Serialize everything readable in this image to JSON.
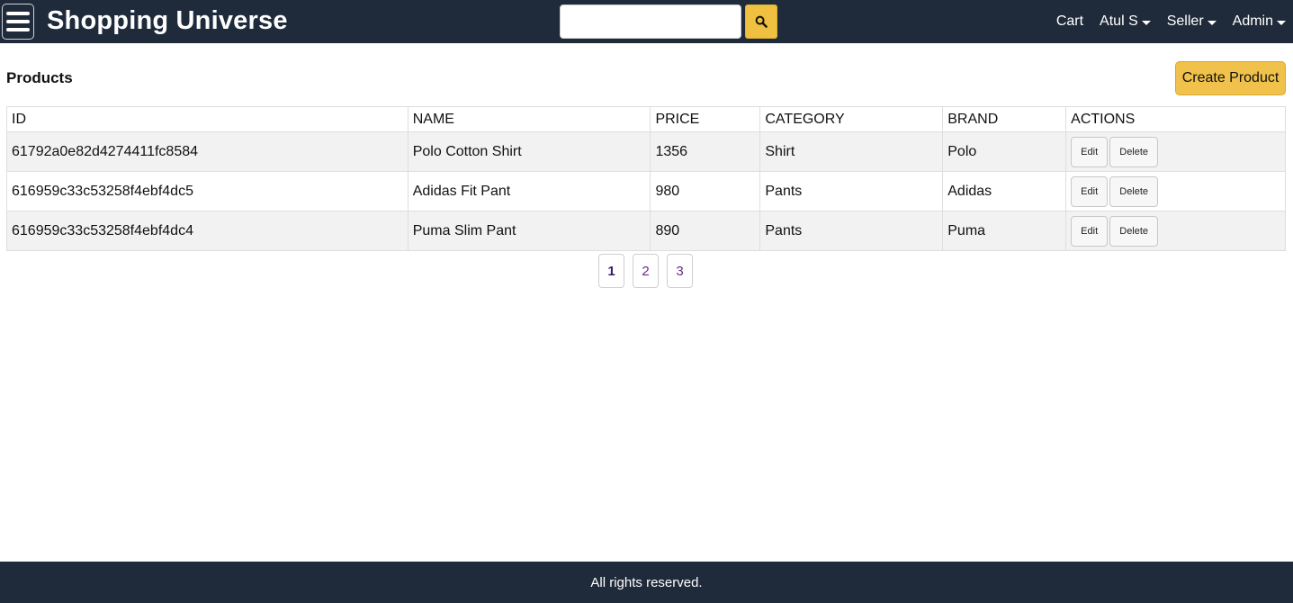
{
  "header": {
    "brand": "Shopping Universe",
    "search": {
      "value": "",
      "placeholder": ""
    },
    "nav": {
      "cart": "Cart",
      "user": "Atul S",
      "seller": "Seller",
      "admin": "Admin"
    }
  },
  "main": {
    "title": "Products",
    "create_button": "Create Product",
    "table": {
      "headers": [
        "ID",
        "NAME",
        "PRICE",
        "CATEGORY",
        "BRAND",
        "ACTIONS"
      ],
      "rows": [
        {
          "id": "61792a0e82d4274411fc8584",
          "name": "Polo Cotton Shirt",
          "price": "1356",
          "category": "Shirt",
          "brand": "Polo"
        },
        {
          "id": "616959c33c53258f4ebf4dc5",
          "name": "Adidas Fit Pant",
          "price": "980",
          "category": "Pants",
          "brand": "Adidas"
        },
        {
          "id": "616959c33c53258f4ebf4dc4",
          "name": "Puma Slim Pant",
          "price": "890",
          "category": "Pants",
          "brand": "Puma"
        }
      ],
      "actions": {
        "edit": "Edit",
        "delete": "Delete"
      }
    },
    "pagination": {
      "pages": [
        "1",
        "2",
        "3"
      ],
      "current": "1"
    }
  },
  "footer": {
    "text": "All rights reserved."
  },
  "colors": {
    "navbar": "#1f2b3b",
    "accent": "#f0c14b"
  }
}
